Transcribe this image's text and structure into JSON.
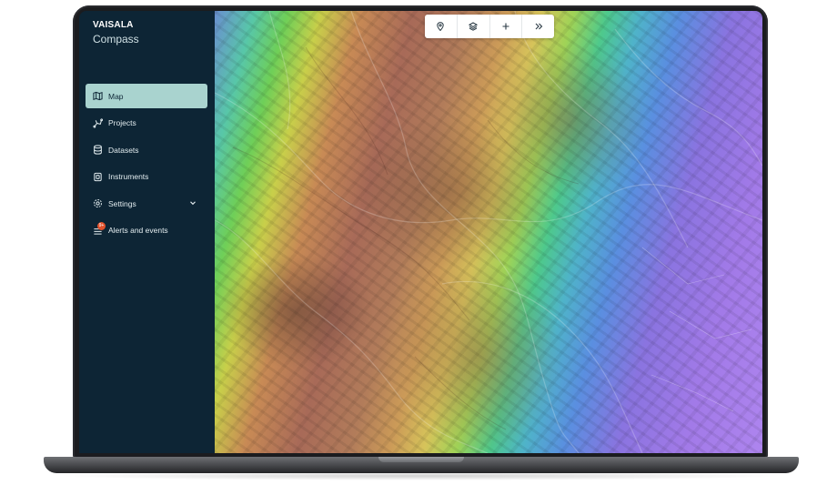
{
  "brand": {
    "company": "VAISALA",
    "product": "Compass"
  },
  "sidebar": {
    "items": [
      {
        "label": "Map",
        "icon": "map-icon",
        "active": true
      },
      {
        "label": "Projects",
        "icon": "projects-icon",
        "active": false
      },
      {
        "label": "Datasets",
        "icon": "database-icon",
        "active": false
      },
      {
        "label": "Instruments",
        "icon": "instrument-icon",
        "active": false
      },
      {
        "label": "Settings",
        "icon": "gear-icon",
        "active": false,
        "expandable": true
      },
      {
        "label": "Alerts and events",
        "icon": "list-icon",
        "active": false,
        "badge": "9+"
      }
    ]
  },
  "toolbar": {
    "buttons": [
      "location-pin-icon",
      "layers-icon",
      "plus-icon",
      "double-chevron-right-icon"
    ]
  },
  "colors": {
    "sidebar_bg": "#0d2535",
    "active_item_bg": "#a9d3cf",
    "badge": "#e2512b"
  }
}
